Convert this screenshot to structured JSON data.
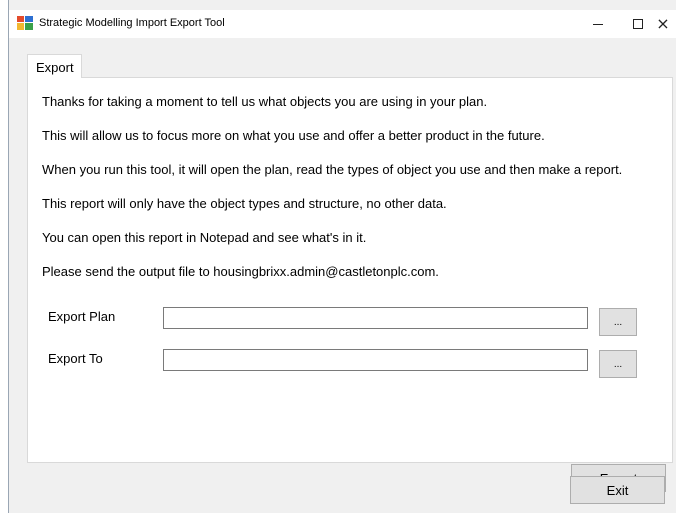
{
  "window": {
    "title": "Strategic Modelling Import Export Tool",
    "icon": "app-icon",
    "controls": {
      "minimize": "minimize-icon",
      "maximize": "maximize-icon",
      "close": "×"
    }
  },
  "tabs": [
    {
      "label": "Export",
      "active": true
    }
  ],
  "intro": {
    "lines": [
      "Thanks for taking a moment to tell us what objects you are using in your plan.",
      "This will allow us to focus more on what you use and offer a better product in the future.",
      "When you run this tool, it will open the plan, read the types of object you use and then make a report.",
      "This report will only have the object types and structure, no other data.",
      "You can open this report in Notepad and see what's in it.",
      "Please send the output file to housingbrixx.admin@castletonplc.com."
    ]
  },
  "fields": {
    "export_plan": {
      "label": "Export Plan",
      "value": "",
      "browse_label": "..."
    },
    "export_to": {
      "label": "Export To",
      "value": "",
      "browse_label": "..."
    }
  },
  "buttons": {
    "export": "Export",
    "exit": "Exit"
  },
  "colors": {
    "window_bg": "#f0f0f0",
    "panel_bg": "#ffffff",
    "button_bg": "#e1e1e1",
    "button_border": "#adadad"
  }
}
